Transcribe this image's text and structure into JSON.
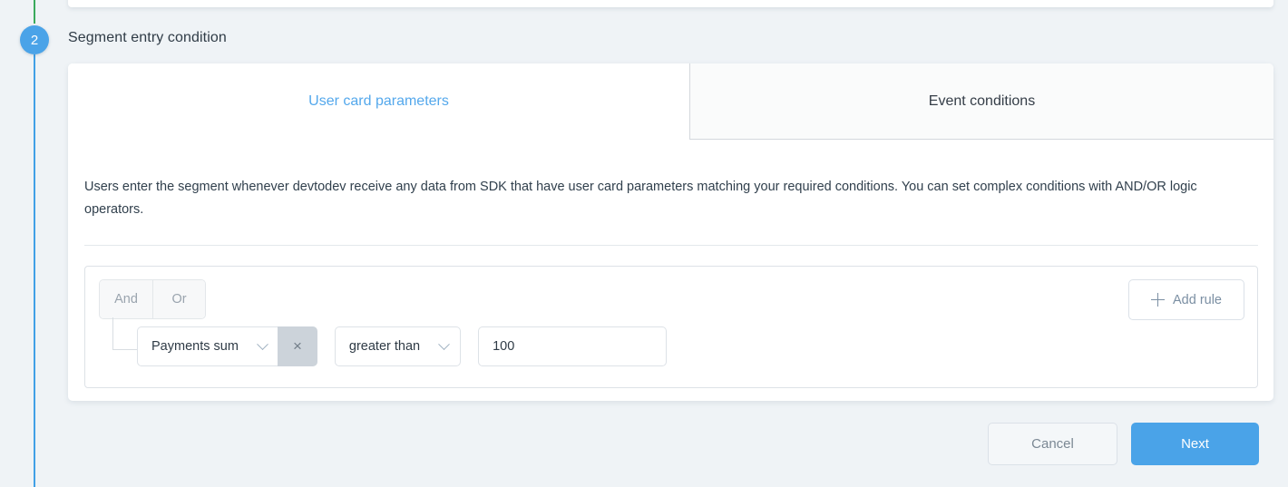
{
  "step": {
    "number": "2",
    "title": "Segment entry condition"
  },
  "tabs": [
    {
      "label": "User card parameters",
      "active": true
    },
    {
      "label": "Event conditions",
      "active": false
    }
  ],
  "description": "Users enter the segment whenever devtodev receive any data from SDK that have user card parameters matching your required conditions. You can set complex conditions with AND/OR logic operators.",
  "rule_builder": {
    "logic_operators": [
      {
        "label": "And",
        "selected": false
      },
      {
        "label": "Or",
        "selected": false
      }
    ],
    "add_rule_label": "Add rule",
    "rules": [
      {
        "field": "Payments sum",
        "operator": "greater than",
        "value": "100",
        "value_placeholder": "",
        "clear_label": "×"
      }
    ]
  },
  "footer": {
    "cancel_label": "Cancel",
    "next_label": "Next"
  },
  "colors": {
    "accent": "#4aa3e8",
    "tab_active_text": "#54a8ec",
    "timeline_complete": "#3aaa5c",
    "timeline_current": "#41a0e6",
    "page_background": "#eff3f6",
    "clear_button": "#ccd3da"
  }
}
